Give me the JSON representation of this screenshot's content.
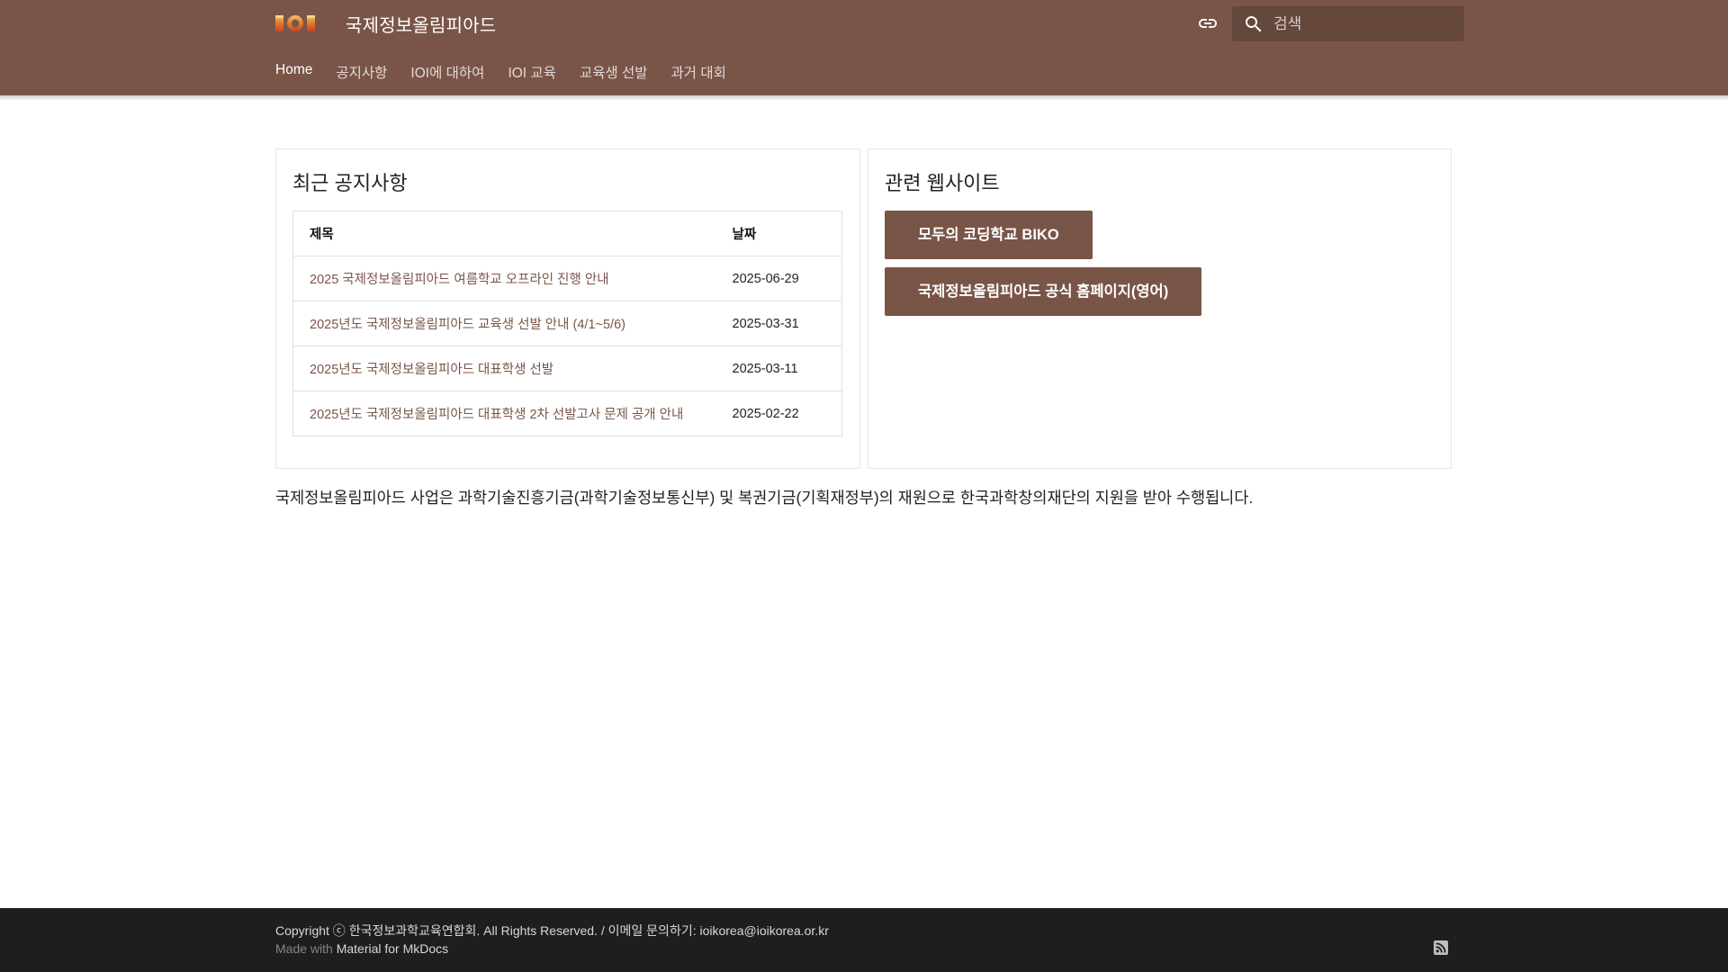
{
  "header": {
    "site_title": "국제정보올림피아드",
    "search_placeholder": "검색",
    "logo_text": "IOI",
    "repo_link_icon": "link-icon",
    "search_icon": "search-icon",
    "background_color": "#795548"
  },
  "tabs": [
    {
      "label": "Home",
      "active": true
    },
    {
      "label": "공지사항",
      "active": false
    },
    {
      "label": "IOI에 대하여",
      "active": false
    },
    {
      "label": "IOI 교육",
      "active": false
    },
    {
      "label": "교육생 선발",
      "active": false
    },
    {
      "label": "과거 대회",
      "active": false
    }
  ],
  "notices": {
    "title": "최근 공지사항",
    "columns": [
      "제목",
      "날짜"
    ],
    "rows": [
      {
        "title": "2025 국제정보올림피아드 여름학교 오프라인 진행 안내",
        "date": "2025-06-29"
      },
      {
        "title": "2025년도 국제정보올림피아드 교육생 선발 안내 (4/1~5/6)",
        "date": "2025-03-31"
      },
      {
        "title": "2025년도 국제정보올림피아드 대표학생 선발",
        "date": "2025-03-11"
      },
      {
        "title": "2025년도 국제정보올림피아드 대표학생 2차 선발고사 문제 공개 안내",
        "date": "2025-02-22"
      }
    ]
  },
  "related_sites": {
    "title": "관련 웹사이트",
    "buttons": [
      "모두의 코딩학교 BIKO",
      "국제정보올림피아드 공식 홈페이지(영어)"
    ]
  },
  "funding_text": "국제정보올림피아드 사업은 과학기술진흥기금(과학기술정보통신부) 및 복권기금(기획재정부)의 재원으로 한국과학창의재단의 지원을 받아 수행됩니다.",
  "footer": {
    "copyright": "Copyright ⓒ 한국정보과학교육연합회. All Rights Reserved. / 이메일 문의하기: ioikorea@ioikorea.or.kr",
    "made_with_prefix": "Made with",
    "made_with_link": "Material for MkDocs",
    "rss_icon": "rss-icon"
  },
  "colors": {
    "primary": "#795548",
    "link": "#7a5548",
    "footer_bg": "#1e1e1e"
  }
}
